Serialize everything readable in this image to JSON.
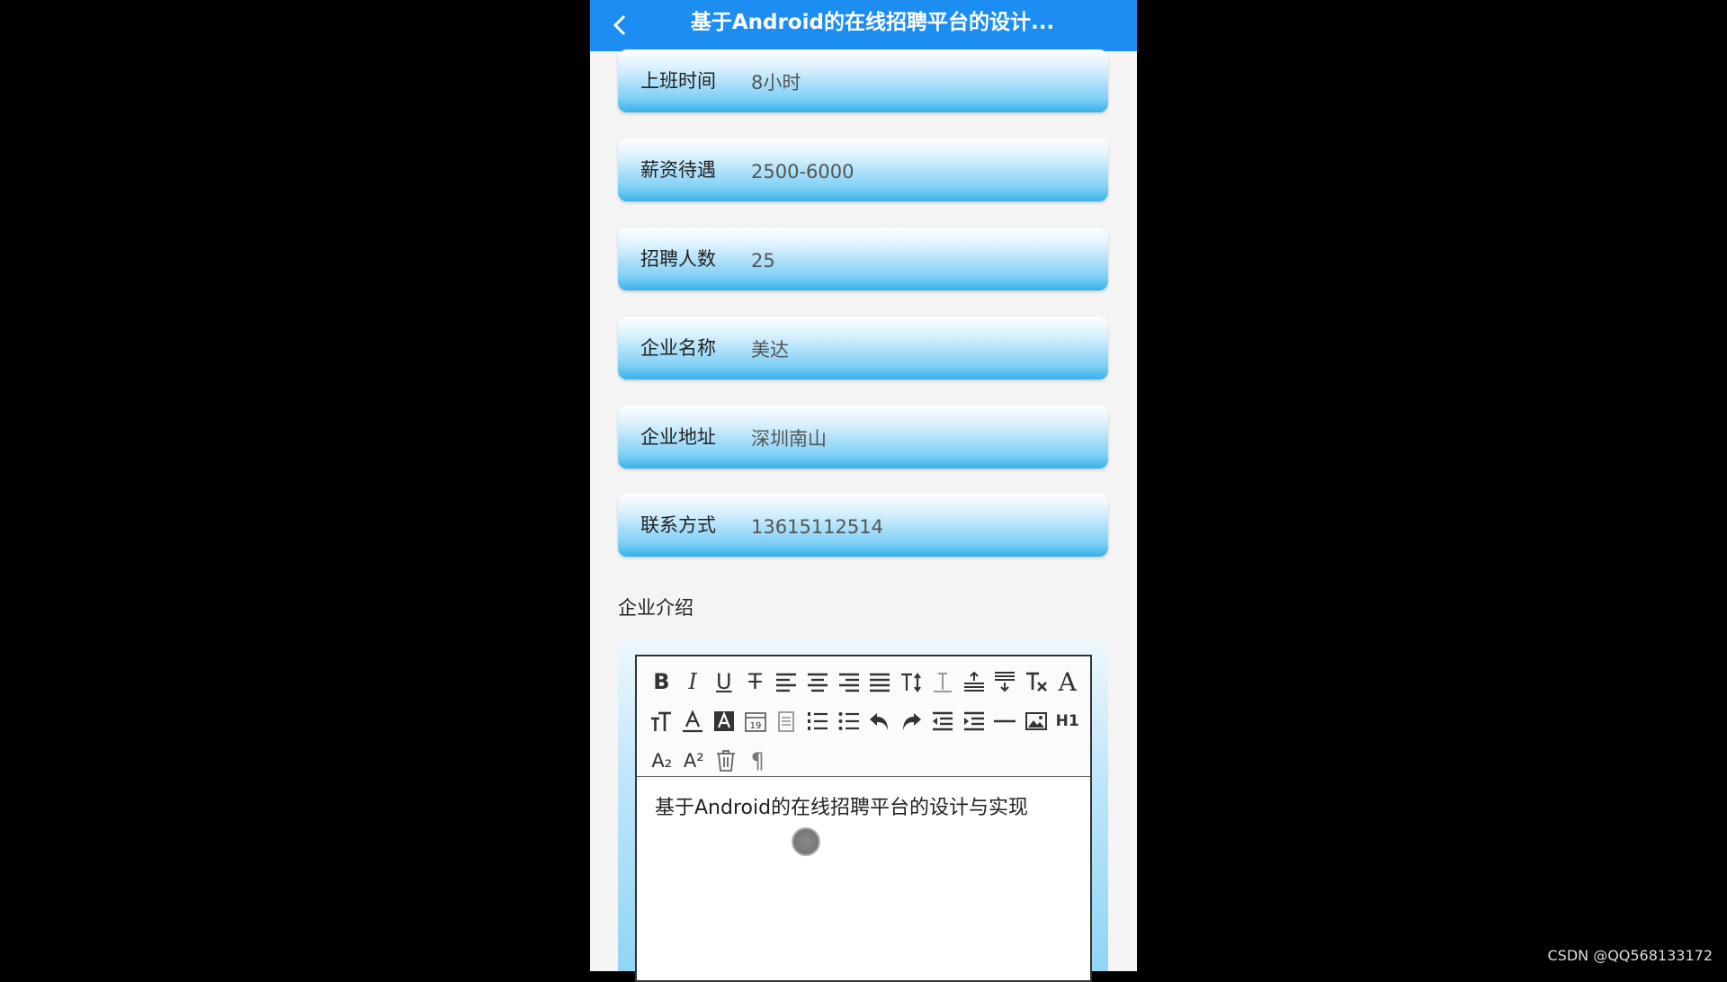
{
  "topbar": {
    "title": "基于Android的在线招聘平台的设计...",
    "back_icon": "chevron-left-icon"
  },
  "fields": [
    {
      "label": "上班时间",
      "value": "8小时"
    },
    {
      "label": "薪资待遇",
      "value": "2500-6000"
    },
    {
      "label": "招聘人数",
      "value": "25"
    },
    {
      "label": "企业名称",
      "value": "美达"
    },
    {
      "label": "企业地址",
      "value": "深圳南山"
    },
    {
      "label": "联系方式",
      "value": "13615112514"
    }
  ],
  "intro": {
    "label": "企业介绍",
    "content": "基于Android的在线招聘平台的设计与实现"
  },
  "toolbar": {
    "row1": [
      "bold",
      "italic",
      "underline",
      "strikethrough",
      "align-left",
      "align-center",
      "align-right",
      "align-justify",
      "line-height",
      "letter-spacing",
      "paragraph-spacing-top",
      "paragraph-spacing-bottom",
      "remove-format",
      "font-family"
    ],
    "row2": [
      "font-size",
      "font-color",
      "background-color",
      "insert-date",
      "insert-table",
      "ordered-list",
      "unordered-list",
      "undo",
      "redo",
      "indent",
      "outdent",
      "horizontal-rule",
      "insert-image",
      "heading-h1"
    ],
    "row3": [
      "subscript",
      "superscript",
      "clear",
      "paragraph"
    ],
    "labels": {
      "bold": "B",
      "italic": "I",
      "underline": "U",
      "strikethrough": "T",
      "h1": "H1",
      "font_family": "A",
      "font_size": "T",
      "sub": "A₂",
      "sup": "A²",
      "para": "¶"
    }
  },
  "watermark": "CSDN @QQ568133172",
  "colors": {
    "topbar": "#1c8ef2",
    "field_gradient_end": "#36b1ea"
  }
}
